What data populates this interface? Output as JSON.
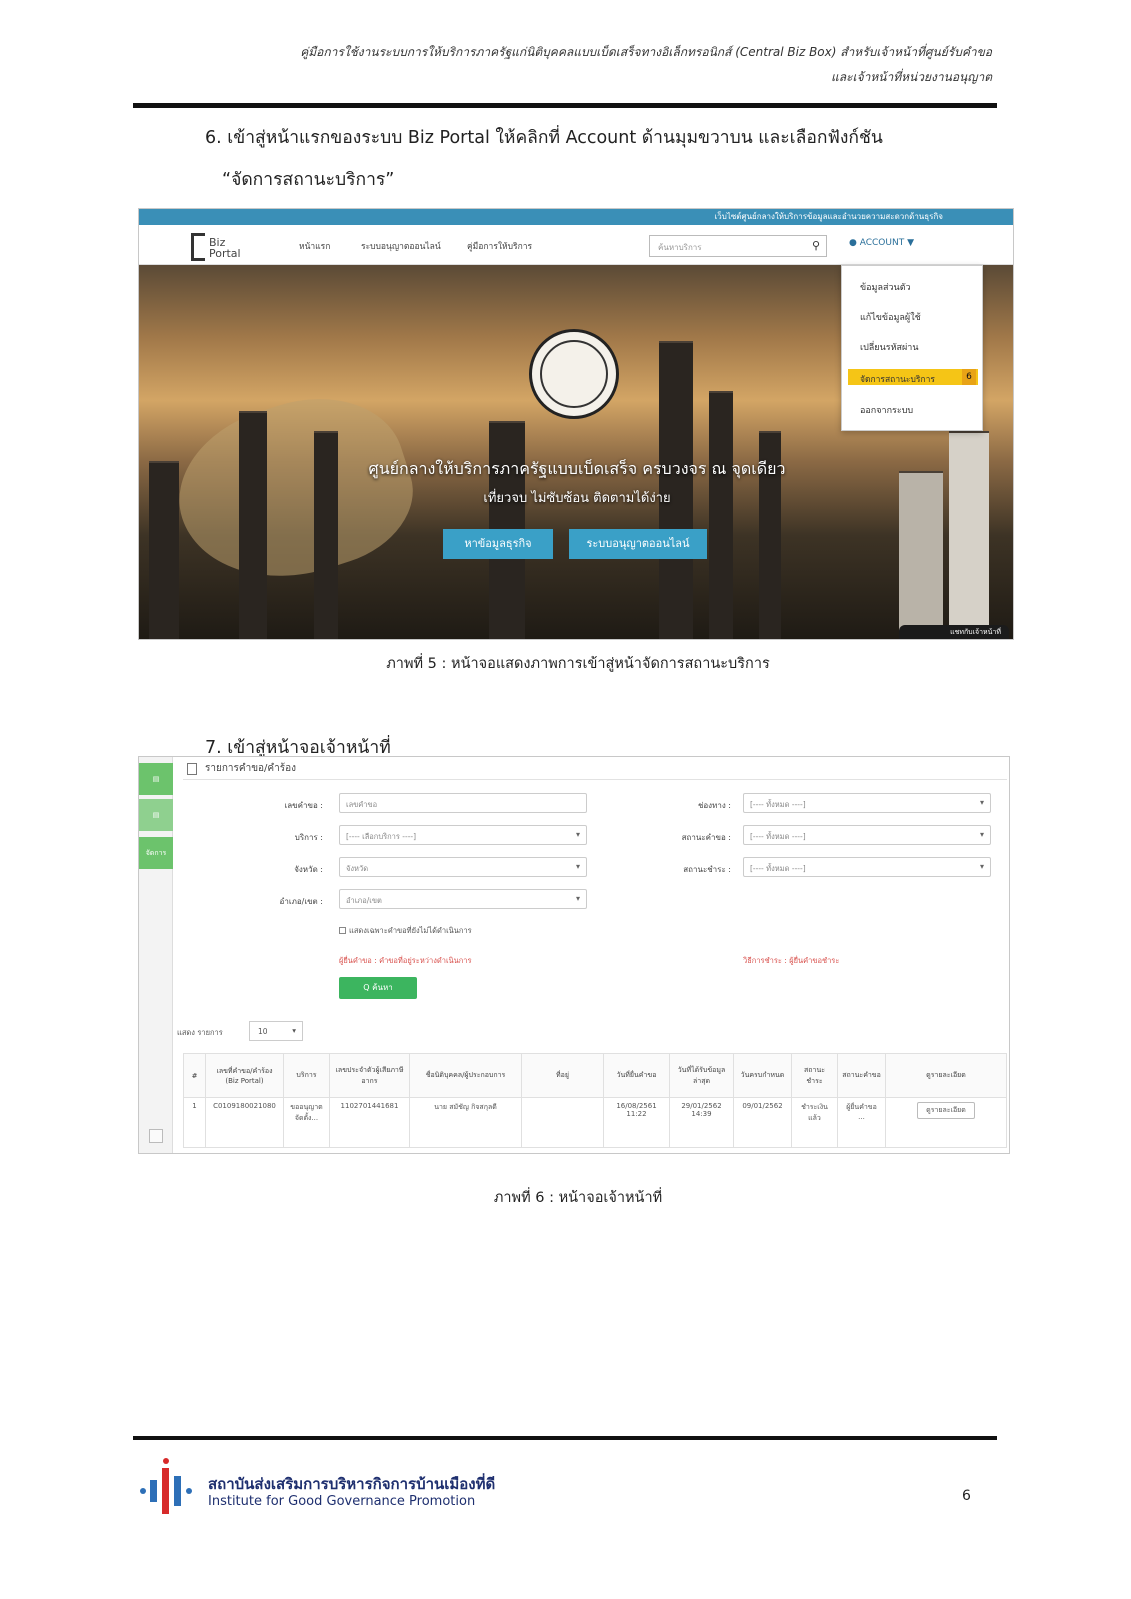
{
  "header": {
    "line1": "คู่มือการใช้งานระบบการให้บริการภาครัฐแก่นิติบุคคลแบบเบ็ดเสร็จทางอิเล็กทรอนิกส์ (Central Biz Box) สำหรับเจ้าหน้าที่ศูนย์รับคำขอ",
    "line2": "และเจ้าหน้าที่หน่วยงานอนุญาต"
  },
  "step6": {
    "text": "6. เข้าสู่หน้าแรกของระบบ Biz Portal ให้คลิกที่ Account ด้านมุมขวาบน และเลือกฟังก์ชัน",
    "sub": "“จัดการสถานะบริการ”"
  },
  "biz_portal": {
    "topbar_text": "เว็บไซต์ศูนย์กลางให้บริการข้อมูลและอำนวยความสะดวกด้านธุรกิจ",
    "logo_line1": "Biz",
    "logo_line2": "Portal",
    "nav": [
      "หน้าแรก",
      "ระบบอนุญาตออนไลน์",
      "คู่มือการให้บริการ"
    ],
    "search_placeholder": "ค้นหาบริการ",
    "search_icon": "search-icon",
    "account_label": "ACCOUNT",
    "dropdown": [
      "ข้อมูลส่วนตัว",
      "แก้ไขข้อมูลผู้ใช้",
      "เปลี่ยนรหัสผ่าน",
      "จัดการสถานะบริการ",
      "ออกจากระบบ"
    ],
    "dropdown_step_number": "6",
    "hero_title": "ศูนย์กลางให้บริการภาครัฐแบบเบ็ดเสร็จ ครบวงจร ณ จุดเดียว",
    "hero_sub": "เที่ยวจบ ไม่ซับซ้อน ติดตามได้ง่าย",
    "buttons": [
      "หาข้อมูลธุรกิจ",
      "ระบบอนุญาตออนไลน์"
    ],
    "chat_label": "แชทกับเจ้าหน้าที่",
    "colors": {
      "topbar": "#3a8fb7",
      "button": "#3aa0c7",
      "highlight": "#f5c516"
    }
  },
  "caption5": "ภาพที่ 5 : หน้าจอแสดงภาพการเข้าสู่หน้าจัดการสถานะบริการ",
  "step7": {
    "text": "7. เข้าสู่หน้าจอเจ้าหน้าที่"
  },
  "officer": {
    "side_tile_label": "จัดการ",
    "page_title": "รายการคำขอ/คำร้อง",
    "filters": {
      "request_no": {
        "label": "เลขคำขอ :",
        "placeholder": "เลขคำขอ"
      },
      "service": {
        "label": "บริการ :",
        "value": "[---- เลือกบริการ ----]"
      },
      "province": {
        "label": "จังหวัด :",
        "value": "จังหวัด"
      },
      "district": {
        "label": "อำเภอ/เขต :",
        "value": "อำเภอ/เขต"
      },
      "channel": {
        "label": "ช่องทาง :",
        "value": "[---- ทั้งหมด ----]"
      },
      "status_a": {
        "label": "สถานะคำขอ :",
        "value": "[---- ทั้งหมด ----]"
      },
      "status_b": {
        "label": "สถานะชำระ :",
        "value": "[---- ทั้งหมด ----]"
      }
    },
    "checkbox_label": "แสดงเฉพาะคำขอที่ยังไม่ได้ดำเนินการ",
    "note_left": "ผู้ยื่นคำขอ : คำขอที่อยู่ระหว่างดำเนินการ",
    "note_right": "วิธีการชำระ : ผู้ยื่นคำขอชำระ",
    "search_button": "Q ค้นหา",
    "show_label": "แสดง รายการ",
    "page_size": "10",
    "table": {
      "headers": [
        "#",
        "เลขที่คำขอ/คำร้อง (Biz Portal)",
        "บริการ",
        "เลขประจำตัวผู้เสียภาษีอากร",
        "ชื่อนิติบุคคล/ผู้ประกอบการ",
        "ที่อยู่",
        "วันที่ยื่นคำขอ",
        "วันที่ได้รับข้อมูลล่าสุด",
        "วันครบกำหนด",
        "สถานะชำระ",
        "สถานะคำขอ",
        "ดูรายละเอียด"
      ],
      "rows": [
        [
          "1",
          "C0109180021080",
          "ขออนุญาตจัดตั้ง...",
          "1102701441681",
          "นาย สมัชัญ กิจสกุลดี",
          "",
          "16/08/2561 11:22",
          "29/01/2562 14:39",
          "09/01/2562",
          "ชำระเงินแล้ว",
          "ผู้ยื่นคำขอ ...",
          "ดูรายละเอียด"
        ]
      ]
    }
  },
  "caption6": "ภาพที่ 6 : หน้าจอเจ้าหน้าที่",
  "footer": {
    "org_th": "สถาบันส่งเสริมการบริหารกิจการบ้านเมืองที่ดี",
    "org_en": "Institute for Good Governance Promotion",
    "page_number": "6"
  }
}
